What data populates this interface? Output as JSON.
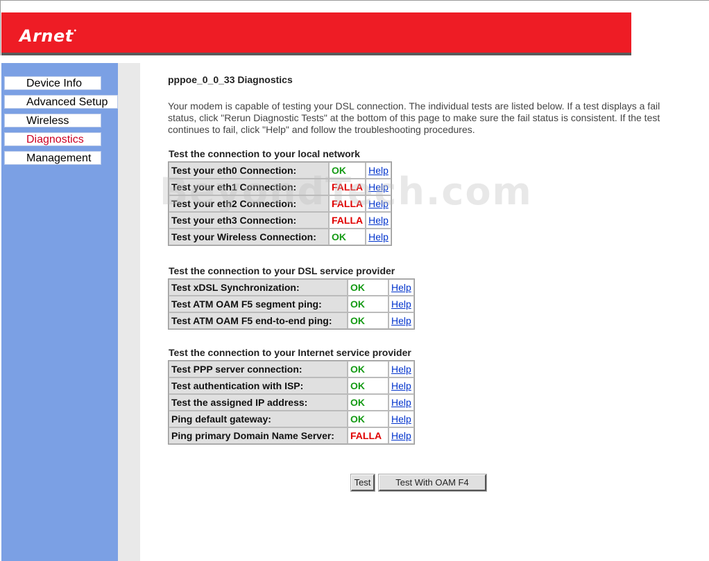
{
  "brand": {
    "logo_text": "Arnet",
    "logo_mark": "•",
    "header_color": "#ee1c25"
  },
  "nav": {
    "items": [
      {
        "label": "Device Info"
      },
      {
        "label": "Advanced Setup"
      },
      {
        "label": "Wireless"
      },
      {
        "label": "Diagnostics",
        "active": true
      },
      {
        "label": "Management"
      }
    ]
  },
  "page": {
    "title": "pppoe_0_0_33 Diagnostics",
    "intro": "Your modem is capable of testing your DSL connection. The individual tests are listed below. If a test displays a fail status, click \"Rerun Diagnostic Tests\" at the bottom of this page to make sure the fail status is consistent. If the test continues to fail, click \"Help\" and follow the troubleshooting procedures."
  },
  "sections": [
    {
      "title": "Test the connection to your local network",
      "tests": [
        {
          "label": "Test your eth0 Connection:",
          "result": "OK",
          "help": "Help"
        },
        {
          "label": "Test your eth1 Connection:",
          "result": "FALLA",
          "help": "Help"
        },
        {
          "label": "Test your eth2 Connection:",
          "result": "FALLA",
          "help": "Help"
        },
        {
          "label": "Test your eth3 Connection:",
          "result": "FALLA",
          "help": "Help"
        },
        {
          "label": "Test your Wireless Connection:",
          "result": "OK",
          "help": "Help"
        }
      ]
    },
    {
      "title": "Test the connection to your DSL service provider",
      "tests": [
        {
          "label": "Test xDSL Synchronization:",
          "result": "OK",
          "help": "Help"
        },
        {
          "label": "Test ATM OAM F5 segment ping:",
          "result": "OK",
          "help": "Help"
        },
        {
          "label": "Test ATM OAM F5 end-to-end ping:",
          "result": "OK",
          "help": "Help"
        }
      ]
    },
    {
      "title": "Test the connection to your Internet service provider",
      "tests": [
        {
          "label": "Test PPP server connection:",
          "result": "OK",
          "help": "Help"
        },
        {
          "label": "Test authentication with ISP:",
          "result": "OK",
          "help": "Help"
        },
        {
          "label": "Test the assigned IP address:",
          "result": "OK",
          "help": "Help"
        },
        {
          "label": "Ping default gateway:",
          "result": "OK",
          "help": "Help"
        },
        {
          "label": "Ping primary Domain Name Server:",
          "result": "FALLA",
          "help": "Help"
        }
      ]
    }
  ],
  "buttons": {
    "test": "Test",
    "test_oam_f4": "Test With OAM F4"
  },
  "watermark": "BeyondTech.com",
  "colors": {
    "ok": "#149a14",
    "fail": "#e00000",
    "link": "#0033cc",
    "sidebar": "#7ba0e4"
  }
}
